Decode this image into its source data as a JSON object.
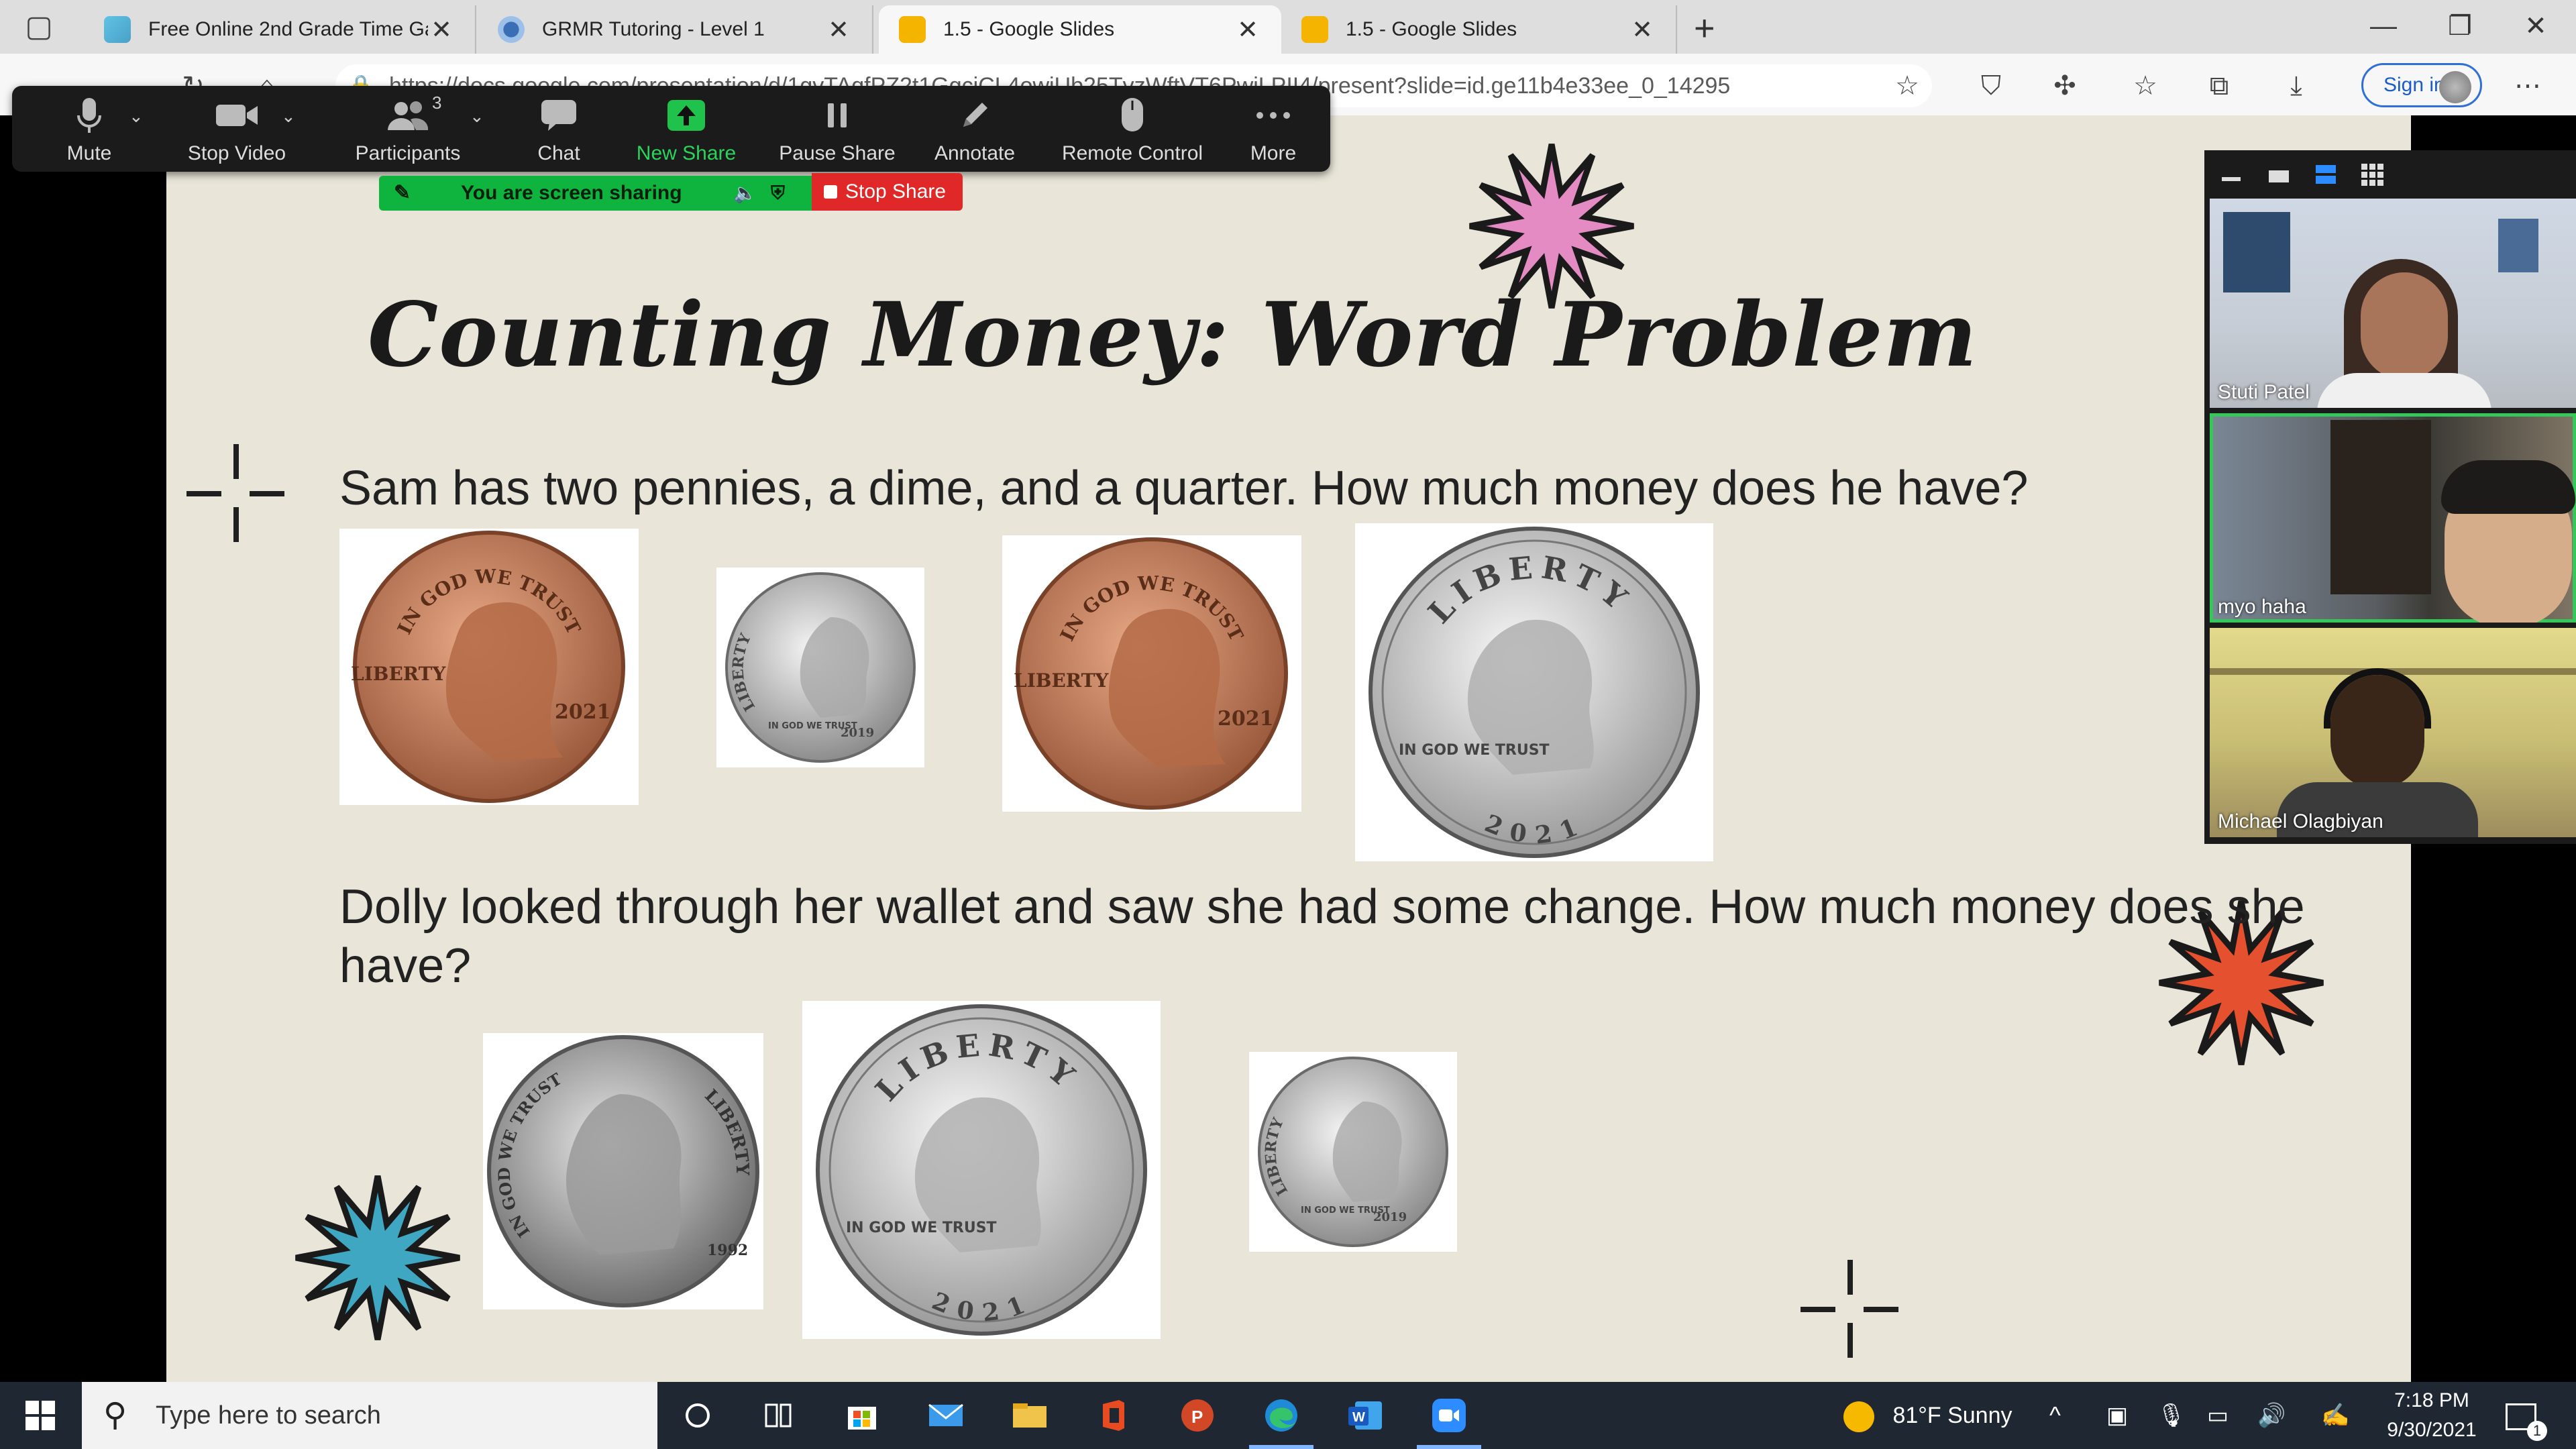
{
  "browser": {
    "tabs": [
      {
        "label": "Free Online 2nd Grade Time Gam",
        "close": "✕"
      },
      {
        "label": "GRMR Tutoring - Level 1",
        "close": "✕"
      },
      {
        "label": "1.5 - Google Slides",
        "close": "✕"
      },
      {
        "label": "1.5 - Google Slides",
        "close": "✕"
      }
    ],
    "new_tab": "+",
    "url": "https://docs.google.com/presentation/d/1gvTAqfPZ2t1GgciCL4owiUb25TvzWftVT6PwjLPII4/present?slide=id.ge11b4e33ee_0_14295",
    "sign_in": "Sign in",
    "window_controls": [
      "—",
      "❐",
      "✕"
    ]
  },
  "zoom": {
    "toolbar": [
      {
        "label": "Mute",
        "icon": "microphone-icon"
      },
      {
        "label": "Stop Video",
        "icon": "video-camera-icon"
      },
      {
        "label": "Participants",
        "icon": "participants-icon",
        "count": "3"
      },
      {
        "label": "Chat",
        "icon": "chat-icon"
      },
      {
        "label": "New Share",
        "icon": "share-up-arrow-icon"
      },
      {
        "label": "Pause Share",
        "icon": "pause-icon"
      },
      {
        "label": "Annotate",
        "icon": "pencil-icon"
      },
      {
        "label": "Remote Control",
        "icon": "mouse-icon"
      },
      {
        "label": "More",
        "icon": "ellipsis-icon"
      }
    ],
    "sharing_banner": "You are screen sharing",
    "stop_share": "Stop Share",
    "participants": [
      {
        "name": "Stuti Patel"
      },
      {
        "name": "myo haha"
      },
      {
        "name": "Michael Olagbiyan"
      }
    ]
  },
  "slide": {
    "title": "Counting Money: Word Problem",
    "question1": "Sam has two pennies, a dime, and a quarter. How much money does he have?",
    "question2": "Dolly looked through her wallet and saw she had some change. How much money does she have?",
    "coins": {
      "penny": {
        "legend": "IN GOD WE TRUST",
        "side": "LIBERTY",
        "year": "2021"
      },
      "dime": {
        "legend": "LIBERTY",
        "motto": "IN GOD WE TRUST",
        "year": "2019"
      },
      "quarter": {
        "legend": "LIBERTY",
        "motto": "IN GOD WE TRUST",
        "year": "2021"
      },
      "nickel": {
        "legend": "IN GOD WE TRUST",
        "side": "LIBERTY",
        "year": "1992"
      }
    },
    "star_colors": {
      "pink": "#e58bc4",
      "red": "#e5502f",
      "teal": "#3fa7c1"
    }
  },
  "taskbar": {
    "search_placeholder": "Type here to search",
    "weather": "81°F  Sunny",
    "time": "7:18 PM",
    "date": "9/30/2021",
    "notification_count": "1"
  }
}
